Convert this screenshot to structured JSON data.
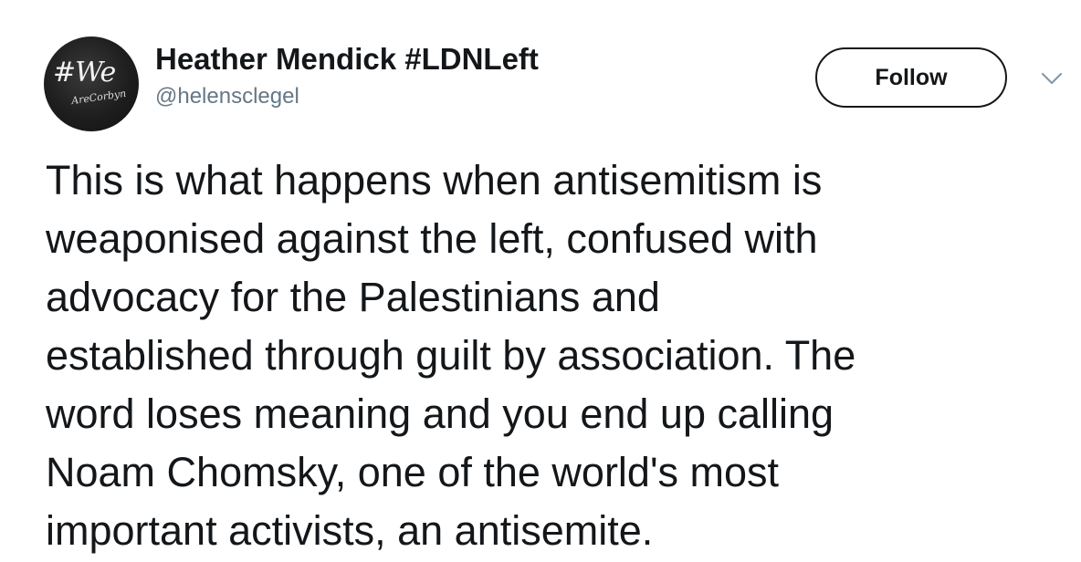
{
  "author": {
    "name": "Heather Mendick #LDNLeft",
    "handle": "@helensclegel",
    "avatar": {
      "main_text": "#We",
      "sub_text": "AreCorbyn"
    }
  },
  "follow_button": {
    "label": "Follow"
  },
  "menu": {
    "icon": "chevron-down-icon"
  },
  "tweet": {
    "lines": [
      "This is what happens when antisemitism is",
      "weaponised against the left, confused with",
      "advocacy for the Palestinians and",
      "established through guilt by association. The",
      "word loses meaning and you end up calling",
      "Noam Chomsky, one of the world's most",
      "important activists, an antisemite."
    ]
  },
  "colors": {
    "text_primary": "#14171a",
    "text_secondary": "#657786",
    "chevron": "#8899a6"
  }
}
